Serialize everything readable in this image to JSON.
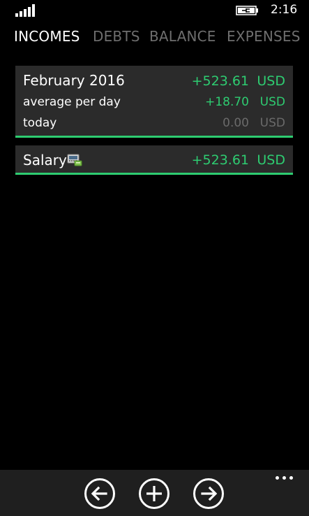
{
  "status": {
    "time": "2:16",
    "icons": [
      "signal-icon",
      "battery-charging-icon"
    ]
  },
  "pivot": {
    "tabs": [
      {
        "label": "INCOMES",
        "active": true
      },
      {
        "label": "DEBTS",
        "active": false
      },
      {
        "label": "BALANCE",
        "active": false
      },
      {
        "label": "EXPENSES",
        "active": false
      }
    ]
  },
  "summary": {
    "period": "February 2016",
    "total": "+523.61",
    "total_currency": "USD",
    "avg_label": "average per day",
    "avg_value": "+18.70",
    "avg_currency": "USD",
    "today_label": "today",
    "today_value": "0.00",
    "today_currency": "USD"
  },
  "entries": [
    {
      "name": "Salary",
      "icon": "payment-terminal-icon",
      "amount": "+523.61",
      "currency": "USD"
    }
  ],
  "appbar": {
    "buttons": [
      "back-arrow-icon",
      "add-icon",
      "forward-arrow-icon"
    ],
    "more": "more-dots-icon"
  },
  "colors": {
    "accent": "#2ecc71",
    "card_bg": "#2b2b2b",
    "inactive_tab": "#6e6e6e",
    "muted_value": "#6a6a6a",
    "appbar_bg": "#1f1f1f"
  }
}
